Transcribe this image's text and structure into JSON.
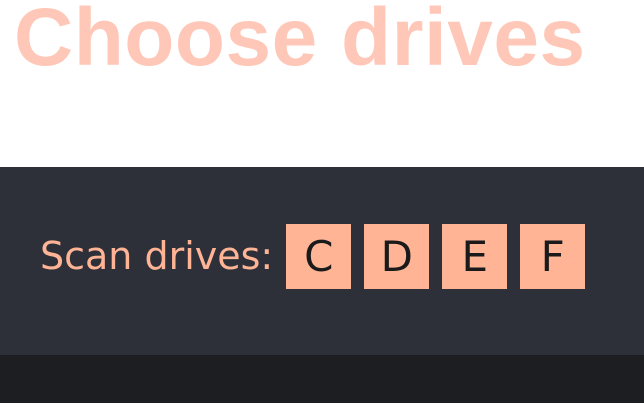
{
  "header": {
    "title": "Choose drives"
  },
  "scan": {
    "label": "Scan drives:",
    "drives": [
      "C",
      "D",
      "E",
      "F"
    ]
  },
  "colors": {
    "title": "#ffc7b7",
    "accent": "#ffb496",
    "panel": "#2e3039",
    "footer": "#1d1e22"
  }
}
